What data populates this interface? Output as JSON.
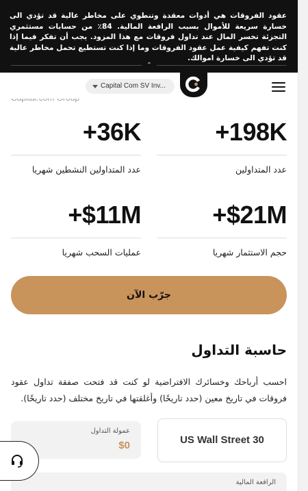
{
  "risk_banner": {
    "text": "عقود الفروقات هي أدوات معقدة وتنطوي على مخاطر عالية قد تؤدي الى خسارة سريعة للأموال بسبب الرافعة المالية. 84٪ من حسابات مستثمري التجزئة تخسر المال عند تداول فروقات مع هذا المزود. يجب أن تفكر فيما إذا كنت تفهم كيفية عمل عقود الفروقات وما إذا كنت تستطيع تحمل مخاطر عالية قد تؤدي الى خسارة اموالك.",
    "collapse_icon": "chevron-up-icon"
  },
  "header": {
    "entity_selector": "Capital Com SV Inv...",
    "logo_icon": "capital-com-logo-icon",
    "menu_icon": "hamburger-menu-icon"
  },
  "partial_heading": "Capital.com Group",
  "stats": [
    {
      "value": "+198K",
      "label": "عدد المتداولين"
    },
    {
      "value": "+36K",
      "label": "عدد المتداولين النشطين شهريا"
    },
    {
      "value": "+$21M",
      "label": "حجم الاستثمار شهريا"
    },
    {
      "value": "+$11M",
      "label": "عمليات السحب شهريا"
    }
  ],
  "cta": {
    "label": "جرّب الآن"
  },
  "calculator": {
    "title": "حاسبة التداول",
    "description": "احسب أرباحك وخسائرك الافتراضية لو كنت قد فتحت صفقة تداول عقود فروقات في تاريخ معين (حدد تاريخًا) وأغلقتها في تاريخ مختلف (حدد تاريخًا).",
    "instrument": "US Wall Street 30",
    "commission_label": "عمولة التداول",
    "commission_value": "$0",
    "leverage_label": "الرافعة المالية"
  },
  "support": {
    "icon": "headset-icon"
  },
  "colors": {
    "accent": "#c9935c",
    "banner_bg": "#111111"
  }
}
